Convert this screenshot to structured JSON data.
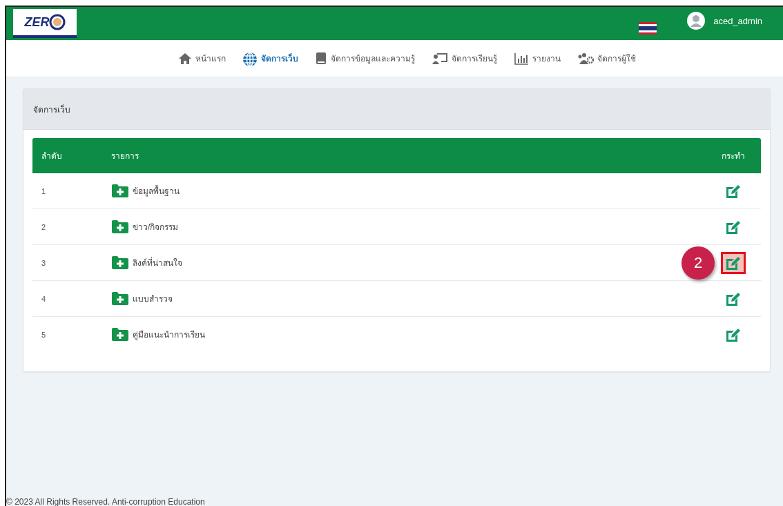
{
  "header": {
    "logo_text": "ZER",
    "user": "aced_admin"
  },
  "nav": [
    {
      "label": "หน้าแรก",
      "selected": false
    },
    {
      "label": "จัดการเว็บ",
      "selected": true
    },
    {
      "label": "จัดการข้อมูลและความรู้",
      "selected": false
    },
    {
      "label": "จัดการเรียนรู้",
      "selected": false
    },
    {
      "label": "รายงาน",
      "selected": false
    },
    {
      "label": "จัดการผู้ใช้",
      "selected": false
    }
  ],
  "panel": {
    "title": "จัดการเว็บ"
  },
  "table": {
    "columns": [
      "ลำดับ",
      "รายการ",
      "กระทำ"
    ],
    "rows": [
      {
        "no": "1",
        "item": "ข้อมูลพื้นฐาน",
        "highlighted": false
      },
      {
        "no": "2",
        "item": "ข่าว/กิจกรรม",
        "highlighted": false
      },
      {
        "no": "3",
        "item": "ลิงค์ที่น่าสนใจ",
        "highlighted": true,
        "callout": "2"
      },
      {
        "no": "4",
        "item": "แบบสำรวจ",
        "highlighted": false
      },
      {
        "no": "5",
        "item": "คู่มือแนะนำการเรียน",
        "highlighted": false
      }
    ]
  },
  "footer": "© 2023 All Rights Reserved. Anti-corruption Education"
}
